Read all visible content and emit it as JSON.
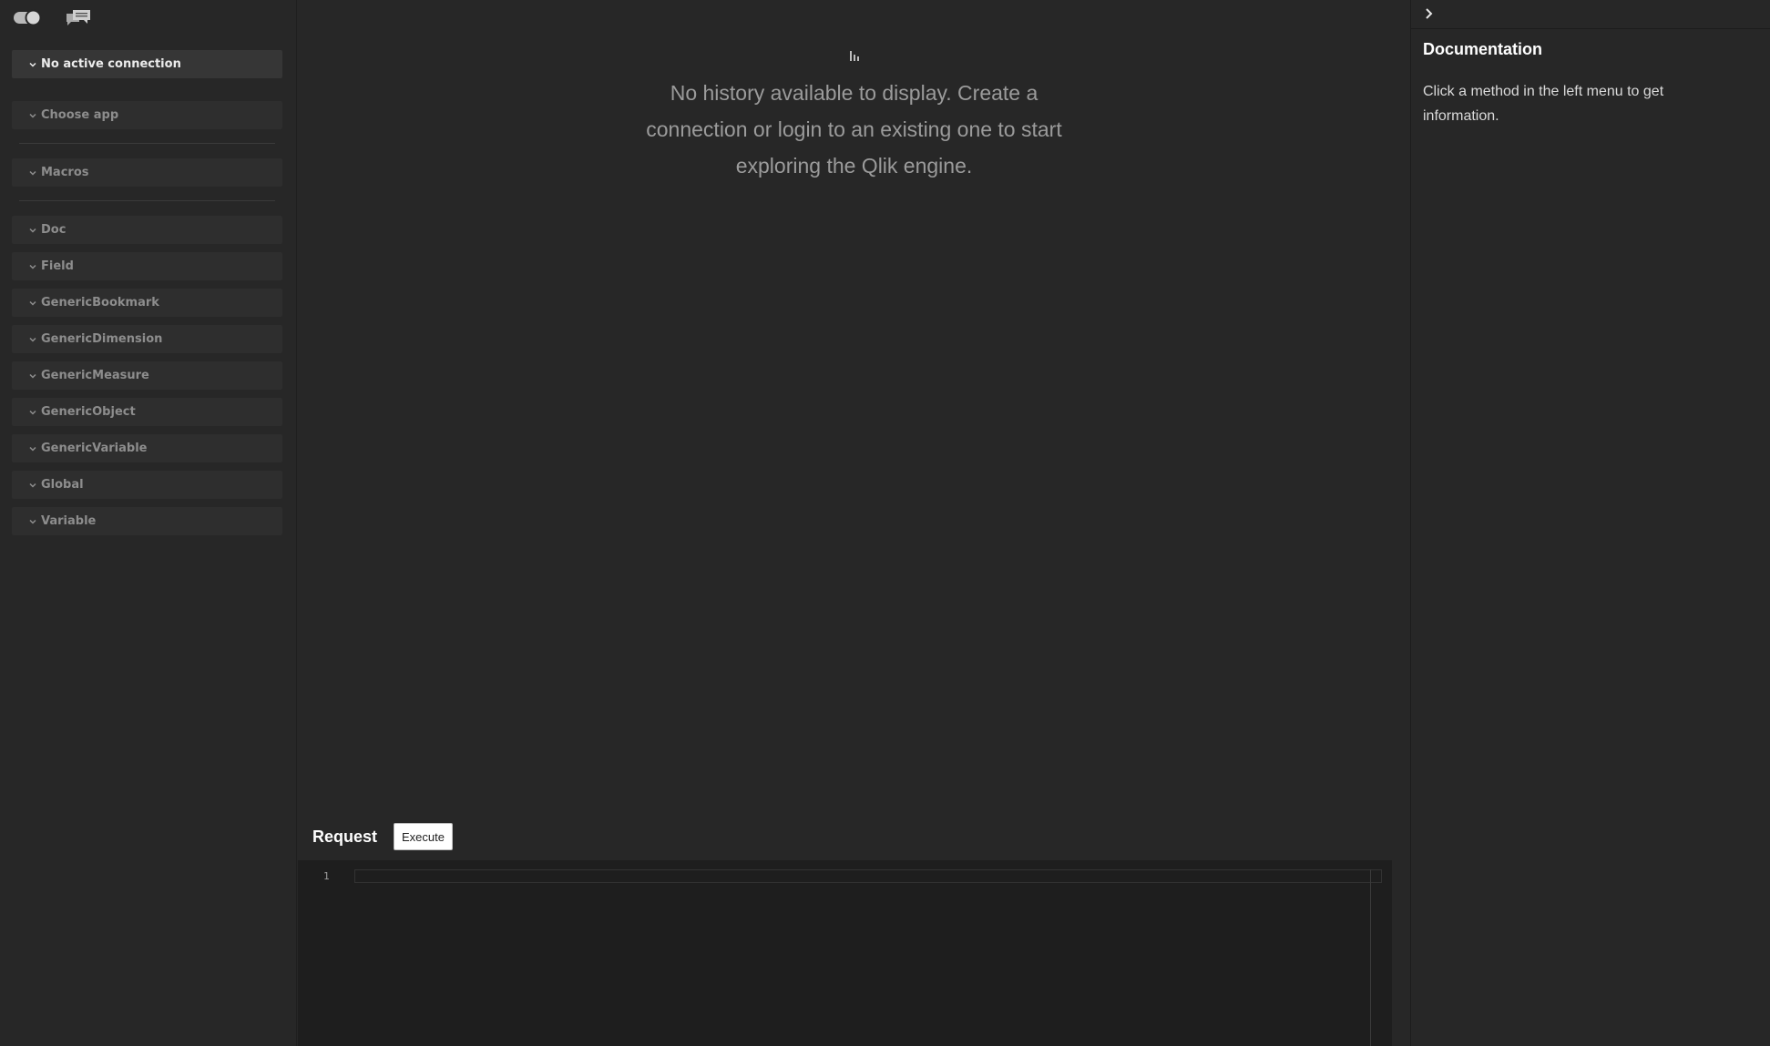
{
  "toolbar": {
    "icons": [
      "connection-toggle-icon",
      "comments-icon"
    ]
  },
  "sidebar": {
    "connection": {
      "label": "No active connection"
    },
    "app": {
      "label": "Choose app"
    },
    "macros": {
      "label": "Macros"
    },
    "classes": [
      {
        "label": "Doc"
      },
      {
        "label": "Field"
      },
      {
        "label": "GenericBookmark"
      },
      {
        "label": "GenericDimension"
      },
      {
        "label": "GenericMeasure"
      },
      {
        "label": "GenericObject"
      },
      {
        "label": "GenericVariable"
      },
      {
        "label": "Global"
      },
      {
        "label": "Variable"
      }
    ]
  },
  "history": {
    "icon": "bar-chart-icon",
    "empty_message": "No history available to display. Create a connection or login to an existing one to start exploring the Qlik engine."
  },
  "request": {
    "title": "Request",
    "execute_label": "Execute",
    "line_number": "1"
  },
  "docs": {
    "collapse_icon": "chevron-right-icon",
    "title": "Documentation",
    "body": "Click a method in the left menu to get information."
  },
  "colors": {
    "background": "#272727",
    "editor_background": "#1e1e1e",
    "active_item": "#363636",
    "inactive_item": "#2e2e2e",
    "button_background": "#ffffff"
  }
}
